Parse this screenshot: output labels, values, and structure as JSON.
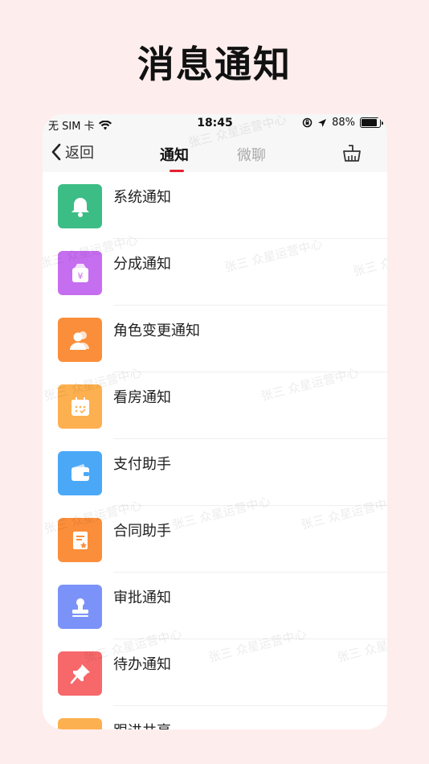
{
  "headline": "消息通知",
  "status_bar": {
    "carrier": "无 SIM 卡",
    "time": "18:45",
    "battery": "88%"
  },
  "nav": {
    "back_label": "返回",
    "tabs": [
      {
        "label": "通知",
        "active": true
      },
      {
        "label": "微聊",
        "active": false
      }
    ]
  },
  "notifications": [
    {
      "label": "系统通知",
      "icon": "bell-icon",
      "color": "#3dbd86"
    },
    {
      "label": "分成通知",
      "icon": "money-bag-icon",
      "color": "#c66ef0"
    },
    {
      "label": "角色变更通知",
      "icon": "users-icon",
      "color": "#fb8e3a"
    },
    {
      "label": "看房通知",
      "icon": "calendar-icon",
      "color": "#fdb050"
    },
    {
      "label": "支付助手",
      "icon": "wallet-icon",
      "color": "#4aa8f7"
    },
    {
      "label": "合同助手",
      "icon": "contract-icon",
      "color": "#fb8e3a"
    },
    {
      "label": "审批通知",
      "icon": "stamp-icon",
      "color": "#7b93f8"
    },
    {
      "label": "待办通知",
      "icon": "pin-icon",
      "color": "#f6686a"
    },
    {
      "label": "跟进共享",
      "icon": "share-icon",
      "color": "#fdb050"
    }
  ],
  "watermark_text": "张三 众星运营中心"
}
